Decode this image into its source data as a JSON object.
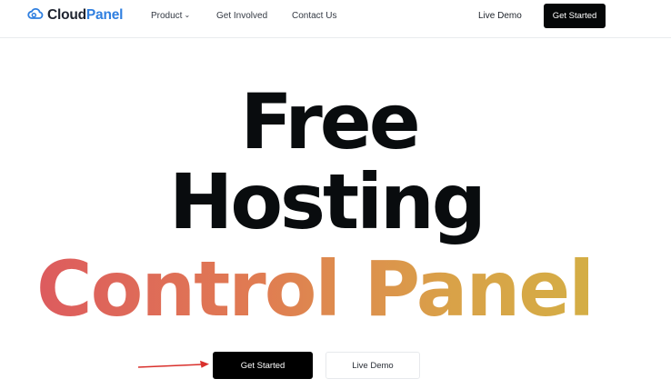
{
  "brand": {
    "name_part1": "Cloud",
    "name_part2": "Panel",
    "logo_icon": "cloud-logo-icon",
    "accent_color": "#2f7fe0"
  },
  "nav": {
    "items": [
      {
        "label": "Product",
        "has_dropdown": true
      },
      {
        "label": "Get Involved"
      },
      {
        "label": "Contact Us"
      }
    ],
    "live_demo": "Live Demo",
    "get_started": "Get Started"
  },
  "hero": {
    "line1": "Free",
    "line2": "Hosting",
    "line3": "Control Panel",
    "gradient_colors": [
      "#dd5b5e",
      "#e07c52",
      "#d9a248",
      "#d4ae45"
    ]
  },
  "cta": {
    "primary": "Get Started",
    "secondary": "Live Demo"
  },
  "annotation": {
    "arrow_color": "#d9302c"
  }
}
